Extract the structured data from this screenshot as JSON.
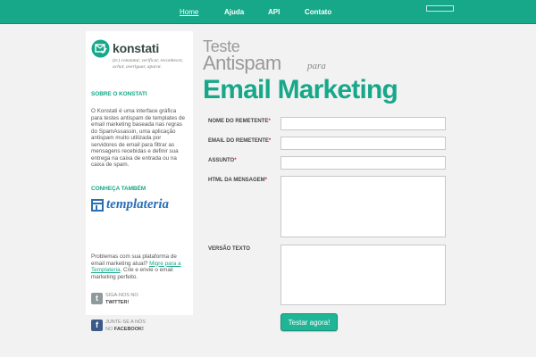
{
  "nav": {
    "items": [
      {
        "label": "Home"
      },
      {
        "label": "Ajuda"
      },
      {
        "label": "API"
      },
      {
        "label": "Contato"
      }
    ]
  },
  "brand": {
    "name": "konstati",
    "tagline": "(tr.) constatar, verificar, reconhecer, achar, averiguar, apurar.",
    "icon": "check-envelope-icon",
    "accent": "#17a88a"
  },
  "sidebar": {
    "sobre_heading": "Sobre o Konstati",
    "sobre_text": "O Konstati é uma interface gráfica para testes antispam de templates de email marketing baseada nas regras do SpamAssassin, uma aplicação antispam muito utilizada por servidores de email para filtrar as mensagens recebidas e definir sua entrega na caixa de entrada ou na caixa de spam.",
    "conheca_heading": "Conheça também",
    "templateria_logo": "templateria",
    "migre_text_before": "Problemas com sua plataforma de email marketing atual? ",
    "migre_link": "Migre para a Templateria",
    "migre_text_after": ". Crie e envie o email marketing perfeito.",
    "twitter_line1": "Siga-nos no",
    "twitter_line2": "Twitter!",
    "facebook_line1": "Junte-se a nós",
    "facebook_line2_prefix": "no",
    "facebook_line2": "Facebook!",
    "twitter_icon": "twitter-icon",
    "facebook_icon": "facebook-icon",
    "twitter_glyph": "t",
    "facebook_glyph": "f"
  },
  "main": {
    "title_line1": "Teste",
    "title_line2": "Antispam",
    "title_para": "para",
    "title_line3": "Email Marketing"
  },
  "form": {
    "fields": [
      {
        "label": "Nome do remetente",
        "required": "*",
        "value": ""
      },
      {
        "label": "Email do remetente",
        "required": "*",
        "value": ""
      },
      {
        "label": "Assunto",
        "required": "*",
        "value": ""
      },
      {
        "label": "HTML da mensagem",
        "required": "*",
        "value": ""
      },
      {
        "label": "Versão texto",
        "required": "",
        "value": ""
      }
    ],
    "submit_label": "Testar agora!"
  }
}
